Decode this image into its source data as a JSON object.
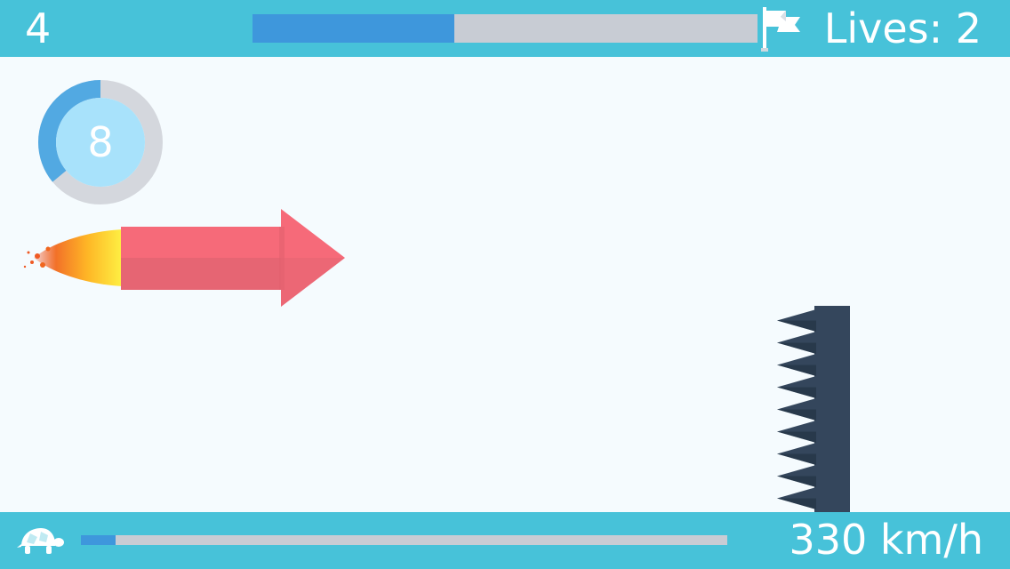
{
  "hud": {
    "level": "4",
    "lives": "Lives: 2",
    "level_progress": 0.4,
    "flag_icon": "finish-flag-icon"
  },
  "timer": {
    "value": "8",
    "remaining_fraction": 0.36
  },
  "speed": {
    "value": "330 km/h",
    "bar_fraction": 0.053,
    "icon": "turtle-icon"
  },
  "colors": {
    "bar": "#47c2d9",
    "progress": "#3e97dc",
    "track": "#c8ccd4",
    "rocket": "#f56b7a",
    "spikes": "#34465c",
    "background": "#f5fbfe"
  }
}
